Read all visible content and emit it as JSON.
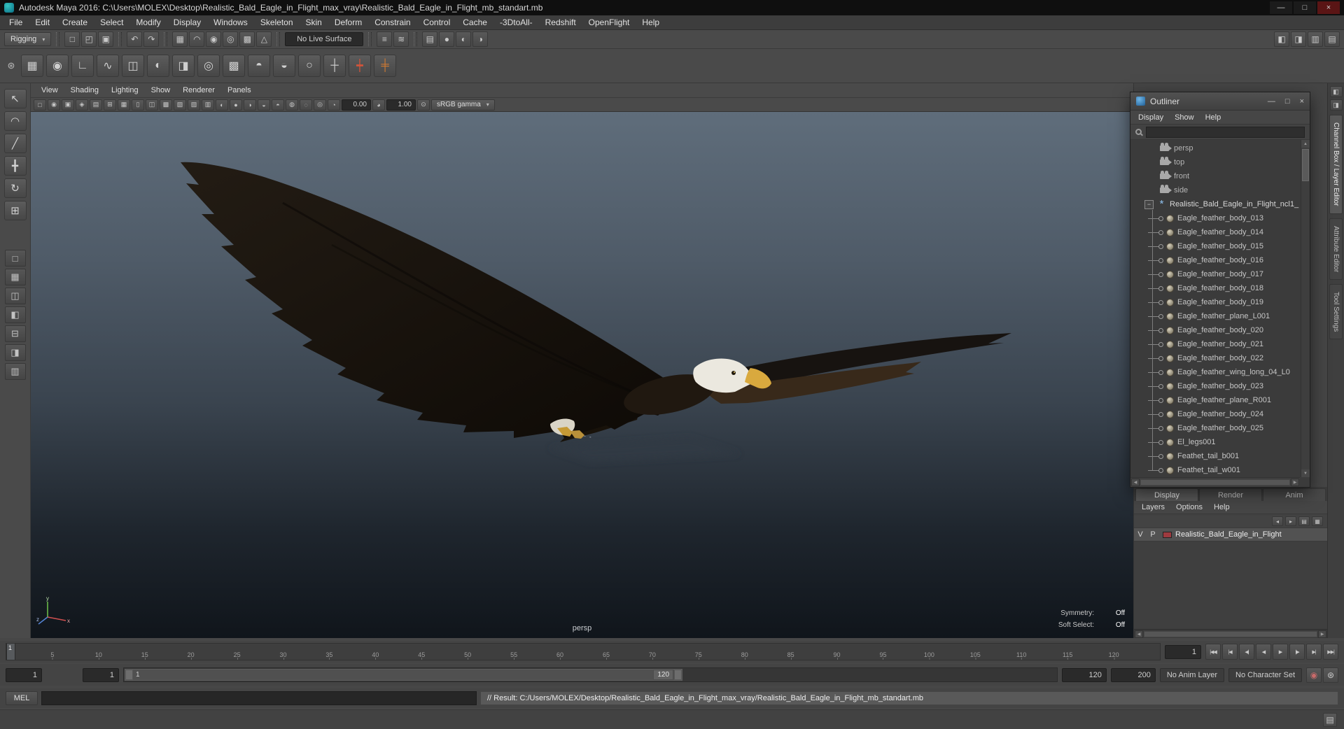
{
  "colors": {
    "viewport_top": "#5f6d7b",
    "viewport_bottom": "#10151b",
    "layer_swatch": "#9e3a3f",
    "group_icon_blue": "#8fc1ef"
  },
  "window": {
    "title": "Autodesk Maya 2016: C:\\Users\\MOLEX\\Desktop\\Realistic_Bald_Eagle_in_Flight_max_vray\\Realistic_Bald_Eagle_in_Flight_mb_standart.mb",
    "minimize": "—",
    "maximize": "□",
    "close": "×"
  },
  "menu_bar": {
    "items": [
      "File",
      "Edit",
      "Create",
      "Select",
      "Modify",
      "Display",
      "Windows",
      "Skeleton",
      "Skin",
      "Deform",
      "Constrain",
      "Control",
      "Cache",
      "-3DtoAll-",
      "Redshift",
      "OpenFlight",
      "Help"
    ]
  },
  "status_line": {
    "menu_set": "Rigging",
    "arrow": "▾",
    "file_icons": [
      {
        "name": "new-scene-icon",
        "glyph": "□"
      },
      {
        "name": "open-scene-icon",
        "glyph": "◰"
      },
      {
        "name": "save-scene-icon",
        "glyph": "▣"
      }
    ],
    "undo_icons": [
      {
        "name": "undo-icon",
        "glyph": "↶"
      },
      {
        "name": "redo-icon",
        "glyph": "↷"
      }
    ],
    "snap_icons": [
      {
        "name": "snap-to-grid-icon",
        "glyph": "▦"
      },
      {
        "name": "snap-to-curve-icon",
        "glyph": "◠"
      },
      {
        "name": "snap-to-point-icon",
        "glyph": "◉"
      },
      {
        "name": "snap-to-projected-center-icon",
        "glyph": "◎"
      },
      {
        "name": "snap-to-view-plane-icon",
        "glyph": "▩"
      },
      {
        "name": "make-object-live-icon",
        "glyph": "△"
      }
    ],
    "live_surface": "No Live Surface",
    "history_icons": [
      {
        "name": "construction-history-icon",
        "glyph": "≡"
      },
      {
        "name": "list-input-operations-icon",
        "glyph": "≋"
      }
    ],
    "render_icons": [
      {
        "name": "open-render-view-icon",
        "glyph": "▤"
      },
      {
        "name": "render-current-frame-icon",
        "glyph": "●"
      },
      {
        "name": "ipr-render-icon",
        "glyph": "◐"
      },
      {
        "name": "render-settings-icon",
        "glyph": "◑"
      }
    ],
    "right_icons": [
      {
        "name": "toggle-ui-elements-icon",
        "glyph": "◧"
      },
      {
        "name": "single-perspective-layout-icon",
        "glyph": "◨"
      },
      {
        "name": "sidebar-attribute-editor-icon",
        "glyph": "▥"
      },
      {
        "name": "sidebar-channel-box-icon",
        "glyph": "▤"
      }
    ]
  },
  "shelf": {
    "gear_glyph": "⊛",
    "items": [
      {
        "name": "grid-snap-shelf-icon",
        "glyph": "▦",
        "color": "#cfcfcf"
      },
      {
        "name": "joint-tool-shelf-icon",
        "glyph": "◉",
        "color": "#cfcfcf"
      },
      {
        "name": "ik-handle-shelf-icon",
        "glyph": "∟",
        "color": "#cfcfcf"
      },
      {
        "name": "ik-spline-shelf-icon",
        "glyph": "∿",
        "color": "#cfcfcf"
      },
      {
        "name": "bind-skin-shelf-icon",
        "glyph": "◫",
        "color": "#cfcfcf"
      },
      {
        "name": "paint-skin-weights-shelf-icon",
        "glyph": "◐",
        "color": "#cfcfcf"
      },
      {
        "name": "mirror-joint-shelf-icon",
        "glyph": "◨",
        "color": "#cfcfcf"
      },
      {
        "name": "cluster-shelf-icon",
        "glyph": "◎",
        "color": "#cfcfcf"
      },
      {
        "name": "lattice-shelf-icon",
        "glyph": "▩",
        "color": "#cfcfcf"
      },
      {
        "name": "blend-shape-shelf-icon",
        "glyph": "◓",
        "color": "#cfcfcf"
      },
      {
        "name": "wrap-deformer-shelf-icon",
        "glyph": "◒",
        "color": "#cfcfcf"
      },
      {
        "name": "control-curve-shelf-icon",
        "glyph": "○",
        "color": "#cfcfcf"
      },
      {
        "name": "locator-shelf-icon",
        "glyph": "┼",
        "color": "#cfcfcf"
      },
      {
        "name": "red-manipulator-shelf-icon",
        "glyph": "┿",
        "color": "#d2543a"
      },
      {
        "name": "orange-manipulator-shelf-icon",
        "glyph": "╪",
        "color": "#d07a32"
      }
    ]
  },
  "toolbox": {
    "tools": [
      {
        "name": "select-tool-icon",
        "glyph": "↖"
      },
      {
        "name": "lasso-select-tool-icon",
        "glyph": "◠"
      },
      {
        "name": "paint-select-tool-icon",
        "glyph": "╱"
      },
      {
        "name": "move-tool-icon",
        "glyph": "╋"
      },
      {
        "name": "rotate-tool-icon",
        "glyph": "↻"
      },
      {
        "name": "scale-tool-icon",
        "glyph": "⊞"
      }
    ],
    "layouts": [
      {
        "name": "single-pane-layout-icon",
        "glyph": "□"
      },
      {
        "name": "four-pane-layout-icon",
        "glyph": "▦"
      },
      {
        "name": "two-pane-side-layout-icon",
        "glyph": "◫"
      },
      {
        "name": "outliner-persp-layout-icon",
        "glyph": "◧"
      },
      {
        "name": "persp-graph-layout-icon",
        "glyph": "⊟"
      },
      {
        "name": "hypershade-persp-layout-icon",
        "glyph": "◨"
      },
      {
        "name": "custom-layout-icon",
        "glyph": "▥"
      }
    ]
  },
  "viewport": {
    "menus": [
      "View",
      "Shading",
      "Lighting",
      "Show",
      "Renderer",
      "Panels"
    ],
    "toolbar_icons": [
      {
        "name": "select-camera-icon",
        "glyph": "□"
      },
      {
        "name": "lock-camera-icon",
        "glyph": "◉"
      },
      {
        "name": "camera-attributes-icon",
        "glyph": "▣"
      },
      {
        "name": "bookmarks-icon",
        "glyph": "◈"
      },
      {
        "name": "image-plane-icon",
        "glyph": "▤"
      },
      {
        "name": "two-d-pan-zoom-icon",
        "glyph": "⊞"
      },
      {
        "name": "grid-toggle-icon",
        "glyph": "▦"
      },
      {
        "name": "film-gate-icon",
        "glyph": "▯"
      },
      {
        "name": "resolution-gate-icon",
        "glyph": "◫"
      },
      {
        "name": "gate-mask-icon",
        "glyph": "▩"
      },
      {
        "name": "field-chart-icon",
        "glyph": "▧"
      },
      {
        "name": "safe-action-icon",
        "glyph": "▨"
      },
      {
        "name": "safe-title-icon",
        "glyph": "▥"
      },
      {
        "name": "default-lighting-icon",
        "glyph": "◐"
      },
      {
        "name": "all-lights-icon",
        "glyph": "●"
      },
      {
        "name": "shadows-icon",
        "glyph": "◑"
      },
      {
        "name": "screen-space-ao-icon",
        "glyph": "◒"
      },
      {
        "name": "motion-blur-icon",
        "glyph": "◓"
      },
      {
        "name": "multisampling-icon",
        "glyph": "◍"
      },
      {
        "name": "xray-icon",
        "glyph": "◌"
      },
      {
        "name": "isolate-select-icon",
        "glyph": "◎"
      }
    ],
    "exposure_icon": "◔",
    "exposure": "0.00",
    "gamma_icon": "◕",
    "gamma": "1.00",
    "color_mgmt_icon": "⊙",
    "view_transform": "sRGB gamma",
    "arrow": "▾",
    "camera_label": "persp",
    "symmetry_label": "Symmetry:",
    "symmetry_value": "Off",
    "soft_select_label": "Soft Select:",
    "soft_select_value": "Off"
  },
  "outliner": {
    "title": "Outliner",
    "minimize": "—",
    "maximize": "□",
    "close": "×",
    "menus": [
      "Display",
      "Show",
      "Help"
    ],
    "search_placeholder": "",
    "items": [
      {
        "label": "persp",
        "type": "camera"
      },
      {
        "label": "top",
        "type": "camera"
      },
      {
        "label": "front",
        "type": "camera"
      },
      {
        "label": "side",
        "type": "camera"
      },
      {
        "label": "Realistic_Bald_Eagle_in_Flight_ncl1_",
        "type": "group"
      },
      {
        "label": "Eagle_feather_body_013",
        "type": "mesh"
      },
      {
        "label": "Eagle_feather_body_014",
        "type": "mesh"
      },
      {
        "label": "Eagle_feather_body_015",
        "type": "mesh"
      },
      {
        "label": "Eagle_feather_body_016",
        "type": "mesh"
      },
      {
        "label": "Eagle_feather_body_017",
        "type": "mesh"
      },
      {
        "label": "Eagle_feather_body_018",
        "type": "mesh"
      },
      {
        "label": "Eagle_feather_body_019",
        "type": "mesh"
      },
      {
        "label": "Eagle_feather_plane_L001",
        "type": "mesh"
      },
      {
        "label": "Eagle_feather_body_020",
        "type": "mesh"
      },
      {
        "label": "Eagle_feather_body_021",
        "type": "mesh"
      },
      {
        "label": "Eagle_feather_body_022",
        "type": "mesh"
      },
      {
        "label": "Eagle_feather_wing_long_04_L0",
        "type": "mesh"
      },
      {
        "label": "Eagle_feather_body_023",
        "type": "mesh"
      },
      {
        "label": "Eagle_feather_plane_R001",
        "type": "mesh"
      },
      {
        "label": "Eagle_feather_body_024",
        "type": "mesh"
      },
      {
        "label": "Eagle_feather_body_025",
        "type": "mesh"
      },
      {
        "label": "El_legs001",
        "type": "mesh"
      },
      {
        "label": "Feathet_tail_b001",
        "type": "mesh"
      },
      {
        "label": "Feathet_tail_w001",
        "type": "mesh"
      }
    ]
  },
  "channel_panel": {
    "tabs": [
      {
        "label": "Display",
        "state": "active"
      },
      {
        "label": "Render",
        "state": ""
      },
      {
        "label": "Anim",
        "state": ""
      }
    ],
    "menus": [
      "Layers",
      "Options",
      "Help"
    ],
    "layer_icons": [
      {
        "name": "move-layer-up-icon",
        "glyph": "◂"
      },
      {
        "name": "move-layer-down-icon",
        "glyph": "▸"
      },
      {
        "name": "new-empty-layer-icon",
        "glyph": "▤"
      },
      {
        "name": "new-layer-from-selected-icon",
        "glyph": "▦"
      }
    ],
    "layer": {
      "visibility": "V",
      "playback": "P",
      "name": "Realistic_Bald_Eagle_in_Flight",
      "swatch_color": "#9e3a3f"
    }
  },
  "right_strip": {
    "icons": [
      {
        "name": "raise-attribute-editor-icon",
        "glyph": "◧"
      },
      {
        "name": "raise-tool-settings-icon",
        "glyph": "◨"
      }
    ],
    "tabs": [
      {
        "label": "Channel Box / Layer Editor",
        "state": "active"
      },
      {
        "label": "Attribute Editor",
        "state": ""
      },
      {
        "label": "Tool Settings",
        "state": ""
      }
    ]
  },
  "time_slider": {
    "ticks": [
      5,
      10,
      15,
      20,
      25,
      30,
      35,
      40,
      45,
      50,
      55,
      60,
      65,
      70,
      75,
      80,
      85,
      90,
      95,
      100,
      105,
      110,
      115,
      120
    ],
    "display_max": 125,
    "current_frame": "1",
    "current_field": "1",
    "playback": [
      {
        "name": "go-to-start-button",
        "glyph": "|◀◀"
      },
      {
        "name": "step-back-key-button",
        "glyph": "|◀"
      },
      {
        "name": "step-back-frame-button",
        "glyph": "◀|"
      },
      {
        "name": "play-backwards-button",
        "glyph": "◀"
      },
      {
        "name": "play-forwards-button",
        "glyph": "▶"
      },
      {
        "name": "step-forward-frame-button",
        "glyph": "|▶"
      },
      {
        "name": "step-forward-key-button",
        "glyph": "▶|"
      },
      {
        "name": "go-to-end-button",
        "glyph": "▶▶|"
      }
    ]
  },
  "range_slider": {
    "anim_start": "1",
    "playback_start": "1",
    "handle_start": "1",
    "handle_end": "120",
    "playback_end": "120",
    "anim_end": "200",
    "anim_layer": "No Anim Layer",
    "character_set": "No Character Set",
    "icons": [
      {
        "name": "auto-keyframe-icon",
        "glyph": "◉",
        "color": "#c96a6a"
      },
      {
        "name": "animation-preferences-icon",
        "glyph": "⊛",
        "color": "#c9c9c9"
      }
    ]
  },
  "command_line": {
    "mode_label": "MEL",
    "input_value": "",
    "result": "// Result: C:/Users/MOLEX/Desktop/Realistic_Bald_Eagle_in_Flight_max_vray/Realistic_Bald_Eagle_in_Flight_mb_standart.mb"
  },
  "help_line": {
    "script_editor_glyph": "▤"
  }
}
